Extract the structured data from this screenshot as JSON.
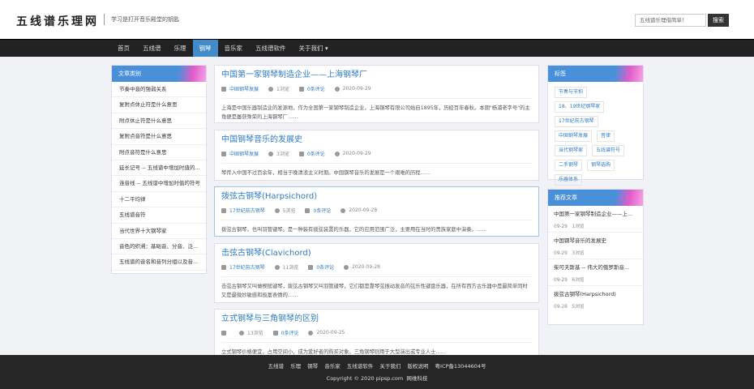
{
  "header": {
    "logo": "五线谱乐理网",
    "slogan": "学习是打开音乐殿堂的钥匙",
    "search_placeholder": "五线谱乐理借简单！",
    "search_button": "搜索"
  },
  "nav": {
    "items": [
      "首页",
      "五线谱",
      "乐理",
      "钢琴",
      "音乐家",
      "五线谱软件",
      "关于我们 ▾"
    ],
    "active_index": 3
  },
  "left": {
    "title": "文章类别",
    "items": [
      "节奏中音的强弱关系",
      "复附点休止符是什么意思",
      "附点休止符是什么意思",
      "复附点音符是什么意思",
      "附点音符是什么意思",
      "延长记号 -- 五线谱中增加时值的...",
      "连音线 -- 五线谱中增加时值的符号",
      "十二平均律",
      "五线谱音符",
      "当代世界十大钢琴家",
      "音色的织溯：基础音、分音、泛...",
      "五线谱的音名和音列分组以及音..."
    ]
  },
  "articles": [
    {
      "title": "中国第一家钢琴制造企业——上海钢琴厂",
      "category": "中国钢琴发展",
      "views": "1浏览",
      "comments": "0条评论",
      "date": "2020-09-29",
      "excerpt": "上海是中国乐器制造业的发源地，作为全国第一家钢琴制造企业，上海钢琴有限公司始自1895年，历经百年春秋。本期\"杨浦老字号\"的主角便是屡获殊荣的上海钢琴厂……"
    },
    {
      "title": "中国钢琴音乐的发展史",
      "category": "中国钢琴发展",
      "views": "3浏览",
      "comments": "0条评论",
      "date": "2020-09-29",
      "excerpt": "琴传入中国不过百余年，相当于晚清浪主义时期。中国钢琴音乐的发展是一个艰难的历程……"
    },
    {
      "title": "拨弦古钢琴(Harpsichord)",
      "category": "17世纪前古钢琴",
      "views": "5浏览",
      "comments": "0条评论",
      "date": "2020-09-28",
      "excerpt": "拨弦古钢琴，也叫羽管键琴。是一种装有拨弦装置的乐器，它的应用范围广泛，主要用在当时的贵族家庭中演奏。……"
    },
    {
      "title": "击弦古钢琴(Clavichord)",
      "category": "17世纪前古钢琴",
      "views": "11浏览",
      "comments": "0条评论",
      "date": "2020-09-28",
      "excerpt": "击弦古钢琴又叫做楔槌键琴，拨弦古钢琴又叫羽管键琴，它们都是靠琴弦振动发音的弦乐性键盘乐器，在所有西方古乐器中是最简单同时又是最微妙敏感和极富表情的……"
    },
    {
      "title": "立式钢琴与三角钢琴的区别",
      "category": "",
      "views": "13浏览",
      "comments": "0条评论",
      "date": "2020-09-25",
      "excerpt": "立式钢琴价格便宜，占用空间小，成为爱好者的购买对象。三角钢琴则用于大型演出或专业人士……"
    }
  ],
  "tags": {
    "title": "标签",
    "items": [
      "节奏与节拍",
      "18、19世纪钢琴家",
      "17世纪前古钢琴",
      "中国钢琴发展",
      "音律",
      "当代钢琴家",
      "五线谱符号",
      "二手钢琴",
      "钢琴选购",
      "乐器体系"
    ]
  },
  "recommended": {
    "title": "推荐文章",
    "items": [
      {
        "title": "中国第一家钢琴制造企业——上...",
        "date": "09-29",
        "views": "1浏览"
      },
      {
        "title": "中国钢琴音乐的发展史",
        "date": "09-29",
        "views": "3浏览"
      },
      {
        "title": "柴可夫斯基 -- 伟大的俄罗斯音...",
        "date": "09-29",
        "views": "6浏览"
      },
      {
        "title": "拨弦古钢琴(Harpsichord)",
        "date": "09-28",
        "views": "5浏览"
      }
    ]
  },
  "footer": {
    "links": [
      "五线谱",
      "乐理",
      "钢琴",
      "音乐家",
      "五线谱软件",
      "关于我们",
      "版权说明",
      "粤ICP备13044604号"
    ],
    "copyright": "Copyright © 2020 pipsp.com",
    "company": "网维科技"
  }
}
